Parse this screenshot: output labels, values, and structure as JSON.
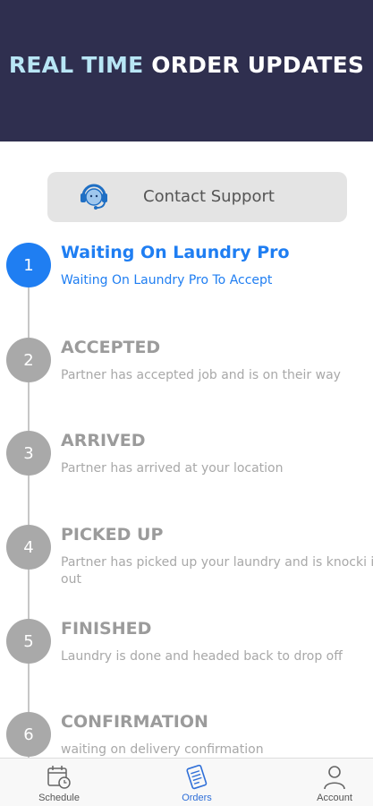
{
  "banner": {
    "title_highlight": "REAL TIME",
    "title_rest": " ORDER UPDATES"
  },
  "support": {
    "label": "Contact Support"
  },
  "steps": [
    {
      "number": "1",
      "title": "Waiting On Laundry Pro",
      "description": "Waiting On Laundry Pro To Accept",
      "active": true
    },
    {
      "number": "2",
      "title": "ACCEPTED",
      "description": "Partner has accepted job and is on their way",
      "active": false
    },
    {
      "number": "3",
      "title": "ARRIVED",
      "description": "Partner has arrived at your location",
      "active": false
    },
    {
      "number": "4",
      "title": "PICKED UP",
      "description": "Partner has picked up your laundry and is knocki it out",
      "active": false
    },
    {
      "number": "5",
      "title": "FINISHED",
      "description": "Laundry is done and headed back to drop off",
      "active": false
    },
    {
      "number": "6",
      "title": "CONFIRMATION",
      "description": "waiting on delivery confirmation",
      "active": false
    }
  ],
  "tabbar": {
    "tabs": [
      {
        "label": "Schedule",
        "icon": "calendar-clock-icon",
        "active": false
      },
      {
        "label": "Orders",
        "icon": "orders-list-icon",
        "active": true
      },
      {
        "label": "Account",
        "icon": "person-icon",
        "active": false
      }
    ]
  },
  "colors": {
    "banner_bg": "#2f2f4f",
    "accent_blue": "#1f7ef2",
    "inactive_gray": "#a9a9a9"
  }
}
